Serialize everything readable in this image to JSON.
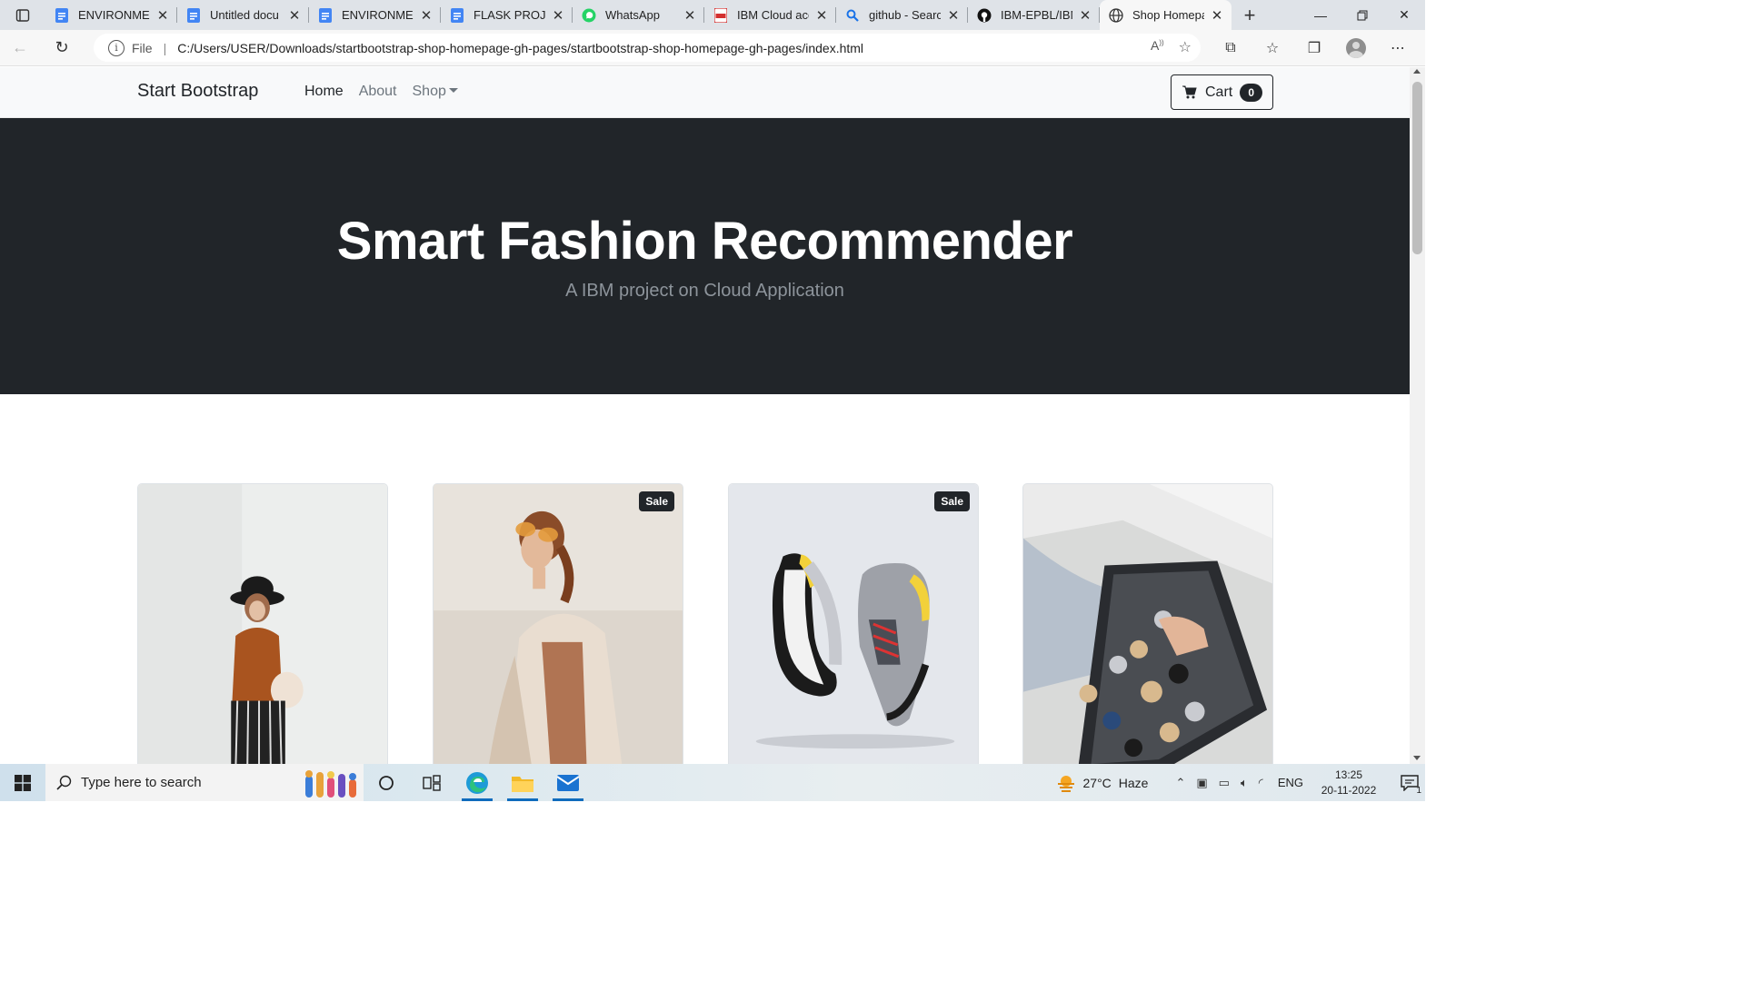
{
  "browser": {
    "tabs": [
      {
        "title": "ENVIRONMEN",
        "icon": "google-docs-icon",
        "color": "#4285f4"
      },
      {
        "title": "Untitled docu",
        "icon": "google-docs-icon",
        "color": "#4285f4"
      },
      {
        "title": "ENVIRONMEN",
        "icon": "google-docs-icon",
        "color": "#4285f4"
      },
      {
        "title": "FLASK PROJEC",
        "icon": "google-docs-icon",
        "color": "#4285f4"
      },
      {
        "title": "WhatsApp",
        "icon": "whatsapp-icon",
        "color": "#25d366"
      },
      {
        "title": "IBM Cloud acc",
        "icon": "pdf-icon",
        "color": "#d32f2f"
      },
      {
        "title": "github - Searc",
        "icon": "search-icon",
        "color": "#1a73e8"
      },
      {
        "title": "IBM-EPBL/IBM",
        "icon": "github-icon",
        "color": "#111111"
      },
      {
        "title": "Shop Homepa",
        "icon": "globe-icon",
        "color": "#333333",
        "active": true
      }
    ],
    "address": {
      "scheme_label": "File",
      "url": "C:/Users/USER/Downloads/startbootstrap-shop-homepage-gh-pages/startbootstrap-shop-homepage-gh-pages/index.html"
    }
  },
  "page": {
    "brand": "Start Bootstrap",
    "nav": {
      "home": "Home",
      "about": "About",
      "shop": "Shop"
    },
    "cart": {
      "label": "Cart",
      "count": "0"
    },
    "hero": {
      "title": "Smart Fashion Recommender",
      "subtitle": "A IBM project on Cloud Application"
    },
    "products": [
      {
        "image": "woman-in-hijab-and-hat-photo",
        "sale": false
      },
      {
        "image": "woman-in-sunglasses-photo",
        "sale": true,
        "badge": "Sale"
      },
      {
        "image": "floating-sneakers-photo",
        "sale": true,
        "badge": "Sale"
      },
      {
        "image": "watch-collection-box-photo",
        "sale": false
      }
    ]
  },
  "taskbar": {
    "search_placeholder": "Type here to search",
    "weather": {
      "temp": "27°C",
      "condition": "Haze"
    },
    "language": "ENG",
    "time": "13:25",
    "date": "20-11-2022",
    "notification_count": "1"
  },
  "colors": {
    "hero_bg": "#212529",
    "nav_bg": "#f8f9fa",
    "accent": "#0f6cbd"
  }
}
